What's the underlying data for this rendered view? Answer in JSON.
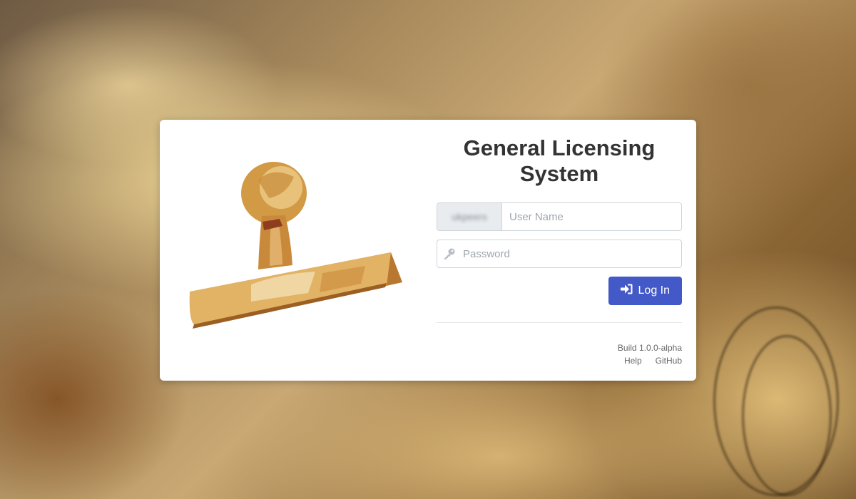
{
  "app": {
    "title": "General Licensing System"
  },
  "login": {
    "domain_addon": "ukpeers",
    "username_placeholder": "User Name",
    "password_placeholder": "Password",
    "login_label": "Log In"
  },
  "footer": {
    "build": "Build 1.0.0-alpha",
    "help_label": "Help",
    "github_label": "GitHub"
  },
  "colors": {
    "accent": "#4459c8",
    "card_bg": "#ffffff",
    "stamp_wood": "#d4a04a"
  },
  "icons": {
    "password": "key-icon",
    "login": "sign-in-icon",
    "logo": "rubber-stamp-icon"
  }
}
